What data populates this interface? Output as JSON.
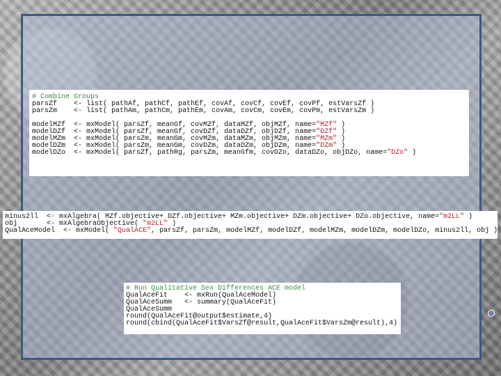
{
  "block1": {
    "comment": "# Combine Groups",
    "lines_a": [
      "parsZf    <- list( pathAf, pathCf, pathEf, covAf, covCf, covEf, covPf, estVarsZf )",
      "parsZm    <- list( pathAm, pathCm, pathEm, covAm, covCm, covEm, covPm, estVarsZm )"
    ],
    "models": [
      {
        "code": "modelMZf  <- mxModel( parsZf, meanGf, covMZf, dataMZf, objMZf, name=",
        "name": "\"MZf\"",
        "end": " )"
      },
      {
        "code": "modelDZf  <- mxModel( parsZf, meanGf, covDZf, dataDZf, objDZf, name=",
        "name": "\"DZf\"",
        "end": " )"
      },
      {
        "code": "modelMZm  <- mxModel( parsZm, meanGm, covMZm, dataMZm, objMZm, name=",
        "name": "\"MZm\"",
        "end": " )"
      },
      {
        "code": "modelDZm  <- mxModel( parsZm, meanGm, covDZm, dataDZm, objDZm, name=",
        "name": "\"DZm\"",
        "end": " )"
      },
      {
        "code": "modelDZo  <- mxModel( parsZf, pathRg, parsZm, meanGfm, covDZo, dataDZo, objDZo, name=",
        "name": "\"DZo\"",
        "end": " )"
      }
    ]
  },
  "block2": {
    "line1_code": "minus2ll  <- mxAlgebra( MZf.objective+ DZf.objective+ MZm.objective+ DZm.objective+ DZo.objective, name=",
    "line1_str": "\"m2LL\"",
    "line1_end": " )",
    "line2_code": "obj       <- mxAlgebraObjective( ",
    "line2_str": "\"m2LL\"",
    "line2_end": " )",
    "line3_code": "QualAceModel  <- mxModel( ",
    "line3_str": "\"QualACE\"",
    "line3_end": ", parsZf, parsZm, modelMZf, modelDZf, modelMZm, modelDZm, modelDZo, minus2ll, obj )"
  },
  "block3": {
    "comment": "# Run Qualitative Sex Differences ACE model",
    "lines": [
      "QualAceFit    <- mxRun(QualAceModel)",
      "QualAceSumm   <- summary(QualAceFit)",
      "QualAceSumm",
      "round(QualAceFit@output$estimate,4)",
      "round(cbind(QualAceFit$VarsZf@result,QualAceFit$VarsZm@result),4)"
    ]
  },
  "colors": {
    "frame": "#3f5884",
    "comment": "#3d8a4a",
    "string": "#b0232b"
  }
}
